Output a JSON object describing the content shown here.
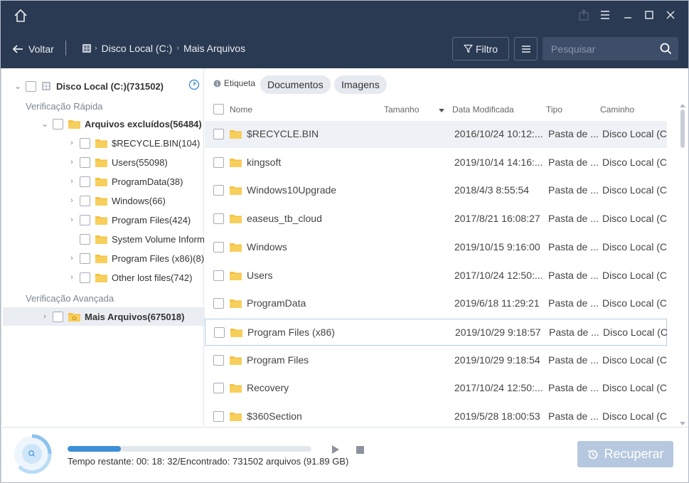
{
  "window": {
    "home_icon": "home-icon",
    "controls": [
      "share-icon",
      "menu-icon",
      "minimize-icon",
      "maximize-icon",
      "close-icon"
    ]
  },
  "nav": {
    "back_label": "Voltar",
    "breadcrumb": [
      "Disco Local (C:)",
      "Mais Arquivos"
    ],
    "filter_label": "Filtro",
    "search_placeholder": "Pesquisar"
  },
  "tree": {
    "root_label": "Disco Local (C:)(731502)",
    "quick_scan_label": "Verificação Rápida",
    "deleted_label": "Arquivos excluídos(56484)",
    "children": [
      {
        "label": "$RECYCLE.BIN(104)",
        "expandable": true
      },
      {
        "label": "Users(55098)",
        "expandable": true
      },
      {
        "label": "ProgramData(38)",
        "expandable": true
      },
      {
        "label": "Windows(66)",
        "expandable": true
      },
      {
        "label": "Program Files(424)",
        "expandable": true
      },
      {
        "label": "System Volume Inform...",
        "expandable": false
      },
      {
        "label": "Program Files (x86)(8)",
        "expandable": true
      },
      {
        "label": "Other lost files(742)",
        "expandable": true
      }
    ],
    "advanced_scan_label": "Verificação Avançada",
    "more_files_label": "Mais Arquivos(675018)"
  },
  "tags": {
    "label": "Etiqueta",
    "chips": [
      "Documentos",
      "Imagens"
    ]
  },
  "table": {
    "headers": {
      "name": "Nome",
      "size": "Tamanho",
      "modified": "Data Modificada",
      "type": "Tipo",
      "path": "Caminho"
    },
    "rows": [
      {
        "name": "$RECYCLE.BIN",
        "modified": "2016/10/24 10:12:...",
        "type": "Pasta de ...",
        "path": "Disco Local (C..."
      },
      {
        "name": "kingsoft",
        "modified": "2019/10/14 14:16:...",
        "type": "Pasta de ...",
        "path": "Disco Local (C..."
      },
      {
        "name": "Windows10Upgrade",
        "modified": "2018/4/3 8:55:54",
        "type": "Pasta de ...",
        "path": "Disco Local (C..."
      },
      {
        "name": "easeus_tb_cloud",
        "modified": "2017/8/21 16:08:27",
        "type": "Pasta de ...",
        "path": "Disco Local (C..."
      },
      {
        "name": "Windows",
        "modified": "2019/10/15 9:16:00",
        "type": "Pasta de ...",
        "path": "Disco Local (C..."
      },
      {
        "name": "Users",
        "modified": "2017/10/24 12:50:...",
        "type": "Pasta de ...",
        "path": "Disco Local (C..."
      },
      {
        "name": "ProgramData",
        "modified": "2019/6/18 11:29:21",
        "type": "Pasta de ...",
        "path": "Disco Local (C..."
      },
      {
        "name": "Program Files (x86)",
        "modified": "2019/10/29 9:18:57",
        "type": "Pasta de ...",
        "path": "Disco Local (C..."
      },
      {
        "name": "Program Files",
        "modified": "2019/10/29 9:18:54",
        "type": "Pasta de ...",
        "path": "Disco Local (C..."
      },
      {
        "name": "Recovery",
        "modified": "2017/10/24 12:50:...",
        "type": "Pasta de ...",
        "path": "Disco Local (C..."
      },
      {
        "name": "$360Section",
        "modified": "2019/5/28 18:00:53",
        "type": "Pasta de ...",
        "path": "Disco Local (C..."
      }
    ]
  },
  "footer": {
    "progress_fraction": 0.22,
    "status_text": "Tempo restante: 00: 18: 32/Encontrado: 731502 arquivos (91.89 GB)",
    "recover_label": "Recuperar"
  },
  "colors": {
    "header_bg": "#2b3a53",
    "folder": "#f5c242",
    "progress": "#3d8fd8",
    "recover_disabled": "#b5c8df"
  }
}
